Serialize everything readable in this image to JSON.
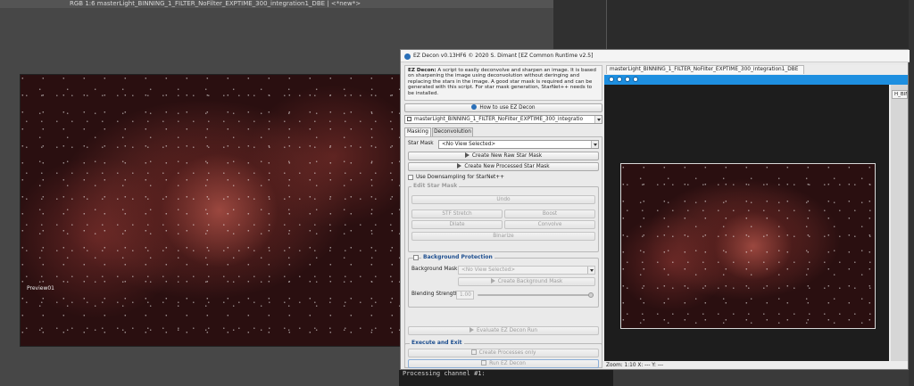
{
  "background_window": {
    "title": "RGB 1:6 masterLight_BINNING_1_FILTER_NoFilter_EXPTIME_300_integration1_DBE | <*new*>",
    "preview_label": "Preview01"
  },
  "console": {
    "lines": [
      "Processing channel #1:"
    ]
  },
  "dialog": {
    "title": "EZ Decon v0.13HF6 © 2020 S. Dimant [EZ Common Runtime v2.5]",
    "description_bold": "EZ Decon:",
    "description": "A script to easily deconvolve and sharpen an image. It is based on sharpening the image using deconvolution without deringing and replacing the stars in the image. A good star mask is required and can be generated with this script. For star mask generation, StarNet++ needs to be installed.",
    "how_to_button": "How to use EZ Decon",
    "target_view": "masterLight_BINNING_1_FILTER_NoFilter_EXPTIME_300_integratio",
    "tabs": [
      "Masking",
      "Deconvolution"
    ],
    "star_mask_label": "Star Mask",
    "star_mask_value": "<No View Selected>",
    "create_raw_star_mask": "Create New Raw Star Mask",
    "create_processed_star_mask": "Create New Processed Star Mask",
    "use_downsampling": "Use Downsampling for StarNet++",
    "edit_star_mask": {
      "title": "Edit Star Mask",
      "undo": "Undo",
      "stf_stretch": "STF Stretch",
      "boost": "Boost",
      "dilate": "Dilate",
      "convolve": "Convolve",
      "binarize": "Binarize"
    },
    "background_protection": {
      "title": "Background Protection",
      "mask_label": "Background Mask",
      "mask_value": "<No View Selected>",
      "create_button": "Create Background Mask",
      "blending_label": "Blending Strength",
      "blending_value": "1.00",
      "blending_fraction": 1.0
    },
    "evaluate_button": "Evaluate EZ Decon Run",
    "execute": {
      "title": "Execute and Exit",
      "create_processes": "Create Processes only",
      "run": "Run EZ Decon"
    },
    "preview": {
      "tab": "masterLight_BINNING_1_FILTER_NoFilter_EXPTIME_300_integration1_DBE",
      "side_tab": "H_BIN",
      "status": "Zoom: 1:10   X: ---   Y: ---"
    }
  },
  "colors": {
    "accent": "#1e8fe0",
    "group_title": "#1d4e8f"
  }
}
